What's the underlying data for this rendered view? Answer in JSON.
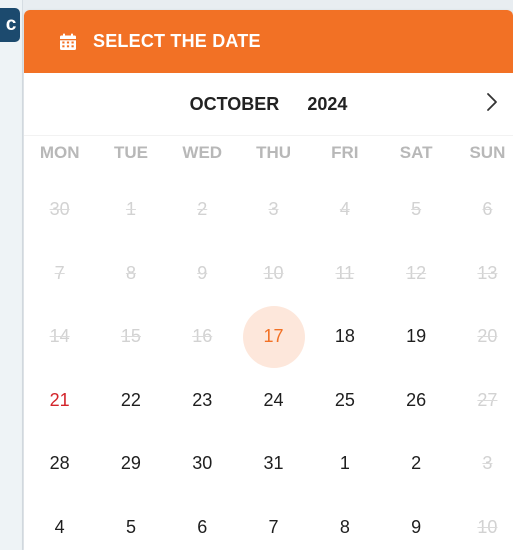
{
  "sidebar": {
    "badge_letter": "c"
  },
  "header": {
    "title": "SELECT THE DATE",
    "icon": "calendar-icon",
    "accent_color": "#f27125"
  },
  "nav": {
    "month": "OCTOBER",
    "year": "2024",
    "next_icon": "chevron-right-icon"
  },
  "weekdays": [
    "MON",
    "TUE",
    "WED",
    "THU",
    "FRI",
    "SAT",
    "SUN"
  ],
  "weeks": [
    [
      {
        "d": "30",
        "s": "muted"
      },
      {
        "d": "1",
        "s": "muted"
      },
      {
        "d": "2",
        "s": "muted"
      },
      {
        "d": "3",
        "s": "muted"
      },
      {
        "d": "4",
        "s": "muted"
      },
      {
        "d": "5",
        "s": "muted"
      },
      {
        "d": "6",
        "s": "muted"
      }
    ],
    [
      {
        "d": "7",
        "s": "muted"
      },
      {
        "d": "8",
        "s": "muted"
      },
      {
        "d": "9",
        "s": "muted"
      },
      {
        "d": "10",
        "s": "muted"
      },
      {
        "d": "11",
        "s": "muted"
      },
      {
        "d": "12",
        "s": "muted"
      },
      {
        "d": "13",
        "s": "muted"
      }
    ],
    [
      {
        "d": "14",
        "s": "muted"
      },
      {
        "d": "15",
        "s": "muted"
      },
      {
        "d": "16",
        "s": "muted"
      },
      {
        "d": "17",
        "s": "today"
      },
      {
        "d": "18",
        "s": "normal"
      },
      {
        "d": "19",
        "s": "normal"
      },
      {
        "d": "20",
        "s": "muted"
      }
    ],
    [
      {
        "d": "21",
        "s": "holiday"
      },
      {
        "d": "22",
        "s": "normal"
      },
      {
        "d": "23",
        "s": "normal"
      },
      {
        "d": "24",
        "s": "normal"
      },
      {
        "d": "25",
        "s": "normal"
      },
      {
        "d": "26",
        "s": "normal"
      },
      {
        "d": "27",
        "s": "muted"
      }
    ],
    [
      {
        "d": "28",
        "s": "normal"
      },
      {
        "d": "29",
        "s": "normal"
      },
      {
        "d": "30",
        "s": "normal"
      },
      {
        "d": "31",
        "s": "normal"
      },
      {
        "d": "1",
        "s": "normal"
      },
      {
        "d": "2",
        "s": "normal"
      },
      {
        "d": "3",
        "s": "muted"
      }
    ],
    [
      {
        "d": "4",
        "s": "normal"
      },
      {
        "d": "5",
        "s": "normal"
      },
      {
        "d": "6",
        "s": "normal"
      },
      {
        "d": "7",
        "s": "normal"
      },
      {
        "d": "8",
        "s": "normal"
      },
      {
        "d": "9",
        "s": "normal"
      },
      {
        "d": "10",
        "s": "muted"
      }
    ]
  ],
  "colors": {
    "today_bg": "#fde7db",
    "holiday": "#d3242a",
    "muted": "#d2d2d2"
  }
}
